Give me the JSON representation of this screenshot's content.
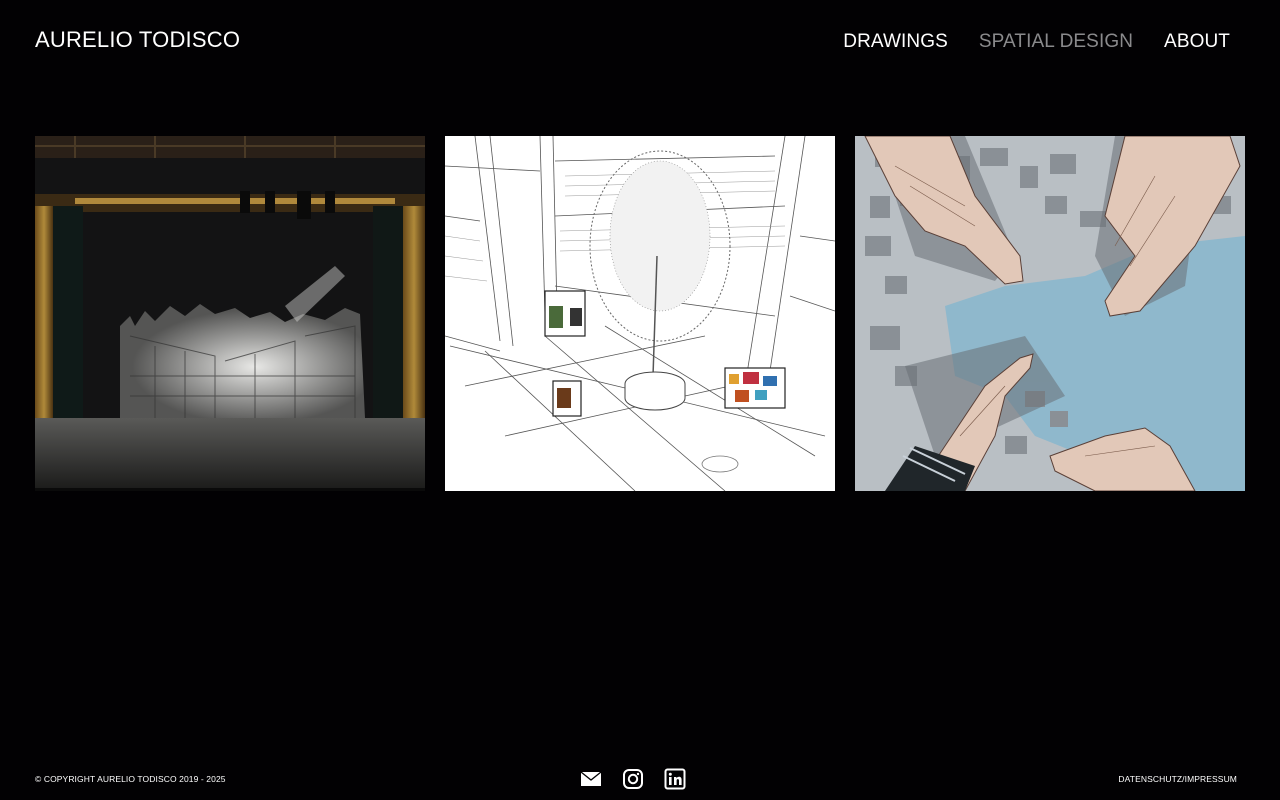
{
  "header": {
    "site_title": "AURELIO TODISCO"
  },
  "nav": {
    "items": [
      {
        "label": "DRAWINGS",
        "active": false
      },
      {
        "label": "SPATIAL DESIGN",
        "active": true
      },
      {
        "label": "ABOUT",
        "active": false
      }
    ]
  },
  "gallery": {
    "items": [
      {
        "subject": "stage-set-photo"
      },
      {
        "subject": "atrium-line-drawing"
      },
      {
        "subject": "hands-on-map-illustration"
      }
    ]
  },
  "footer": {
    "copyright": "© COPYRIGHT AURELIO TODISCO 2019 - 2025",
    "icons": [
      "mail-icon",
      "instagram-icon",
      "linkedin-icon"
    ],
    "legal_link": "DATENSCHUTZ/IMPRESSUM"
  },
  "colors": {
    "background": "#020103",
    "text": "#ffffff",
    "nav_active": "#8a8a8c",
    "water_blue": "#8fb8cc"
  }
}
